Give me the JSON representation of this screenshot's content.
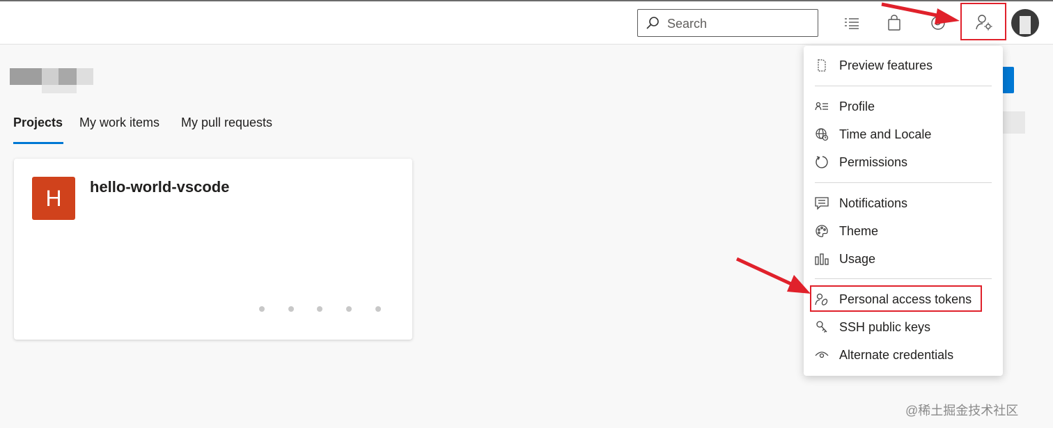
{
  "header": {
    "search_placeholder": "Search",
    "icons": [
      "work-items-icon",
      "marketplace-bag-icon",
      "help-icon",
      "user-settings-icon",
      "avatar"
    ]
  },
  "tabs": [
    {
      "label": "Projects",
      "active": true
    },
    {
      "label": "My work items",
      "active": false
    },
    {
      "label": "My pull requests",
      "active": false
    }
  ],
  "project": {
    "initial": "H",
    "name": "hello-world-vscode",
    "badge_color": "#d0421c"
  },
  "menu": {
    "items": [
      {
        "label": "Preview features",
        "icon": "document-icon"
      },
      {
        "label": "Profile",
        "icon": "profile-icon"
      },
      {
        "label": "Time and Locale",
        "icon": "globe-icon"
      },
      {
        "label": "Permissions",
        "icon": "refresh-icon"
      },
      {
        "label": "Notifications",
        "icon": "notification-icon"
      },
      {
        "label": "Theme",
        "icon": "palette-icon"
      },
      {
        "label": "Usage",
        "icon": "bar-chart-icon"
      },
      {
        "label": "Personal access tokens",
        "icon": "token-icon",
        "highlighted": true
      },
      {
        "label": "SSH public keys",
        "icon": "key-icon"
      },
      {
        "label": "Alternate credentials",
        "icon": "eye-icon"
      }
    ]
  },
  "annotation_color": "#e0212b",
  "accent_color": "#0078d4",
  "watermark": "@稀土掘金技术社区"
}
